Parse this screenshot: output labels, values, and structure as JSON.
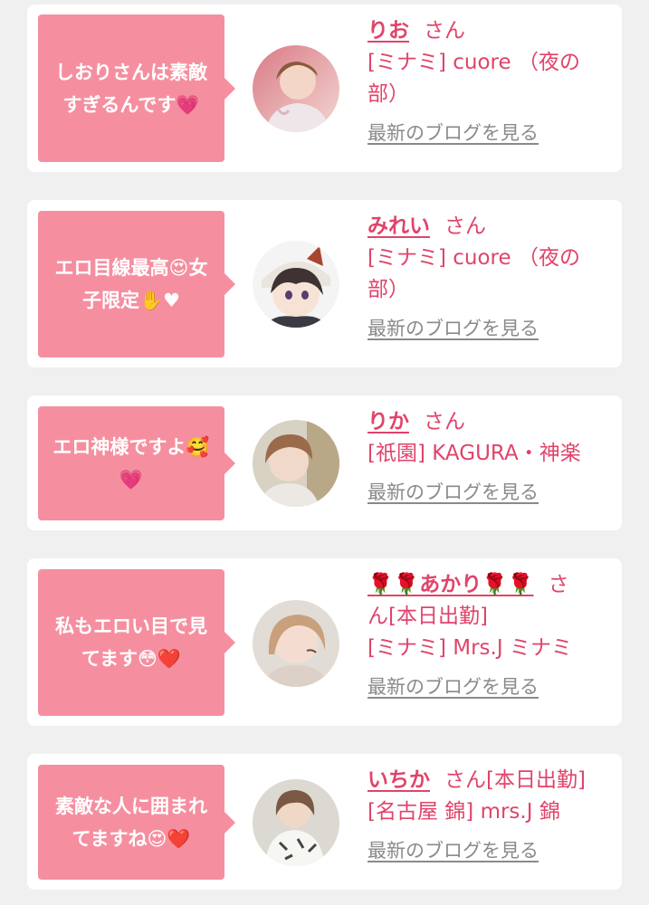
{
  "colors": {
    "accent": "#e0446a",
    "bubble": "#f58fa0",
    "link_gray": "#8a8a8a",
    "background": "#f0f0f0"
  },
  "items": [
    {
      "message_line1": "しおりさんは素敵",
      "message_line2": "すぎるんです💗",
      "name": "りお",
      "honorific": "さん",
      "extra": "",
      "shop": "[ミナミ] cuore （夜の部）",
      "blog_link": "最新のブログを見る",
      "avatar_icon": "avatar-photo"
    },
    {
      "message_line1": "エロ目線最高😍女",
      "message_line2": "子限定✋♥",
      "name": "みれい",
      "honorific": "さん",
      "extra": "",
      "shop": "[ミナミ] cuore （夜の部）",
      "blog_link": "最新のブログを見る",
      "avatar_icon": "avatar-anime"
    },
    {
      "message_line1": "エロ神様ですよ🥰",
      "message_line2": "💗",
      "name": "りか",
      "honorific": "さん",
      "extra": "",
      "shop": "[祇園] KAGURA・神楽",
      "blog_link": "最新のブログを見る",
      "avatar_icon": "avatar-photo"
    },
    {
      "message_line1": "私もエロい目で見",
      "message_line2": "てます😳❤️",
      "name": "🌹🌹あかり🌹🌹",
      "honorific": "さ",
      "extra": "ん[本日出勤]",
      "shop": "[ミナミ] Mrs.J ミナミ",
      "blog_link": "最新のブログを見る",
      "avatar_icon": "avatar-photo"
    },
    {
      "message_line1": "素敵な人に囲まれ",
      "message_line2": "てますね😍❤️",
      "name": "いちか",
      "honorific": "さん[本日出勤]",
      "extra": "",
      "shop": "[名古屋 錦] mrs.J 錦",
      "blog_link": "最新のブログを見る",
      "avatar_icon": "avatar-photo"
    }
  ]
}
